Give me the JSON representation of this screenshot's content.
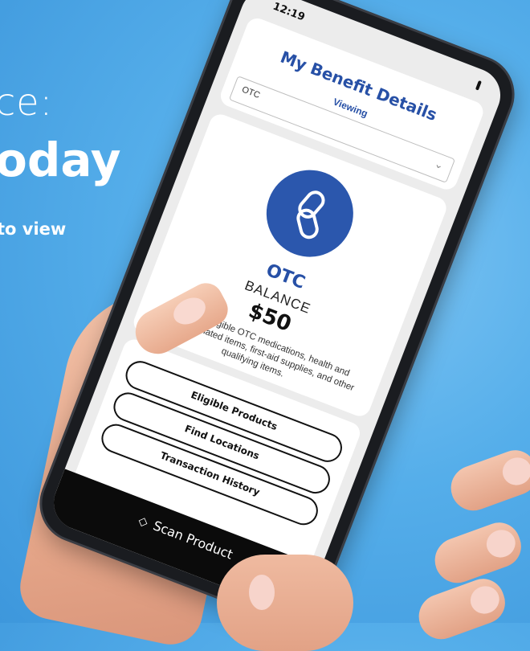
{
  "headline": {
    "line1": "ce:",
    "line2": "oday",
    "line3": "to view"
  },
  "status": {
    "time": "12:19"
  },
  "benefit": {
    "title": "My Benefit Details",
    "viewing_label": "Viewing",
    "selected_option": "OTC"
  },
  "balance_card": {
    "icon": "pill-capsule-icon",
    "category": "OTC",
    "balance_label": "BALANCE",
    "balance_value": "$50",
    "description": "Shop for eligible OTC medications, health and wellness-related items, first-aid supplies, and other qualifying items."
  },
  "actions": {
    "eligible_products": "Eligible Products",
    "find_locations": "Find Locations",
    "transaction_history": "Transaction History"
  },
  "scan": {
    "label": "Scan Product",
    "icon": "tag-icon"
  },
  "colors": {
    "brand_blue": "#2b57ad",
    "background": "#55aeea"
  }
}
